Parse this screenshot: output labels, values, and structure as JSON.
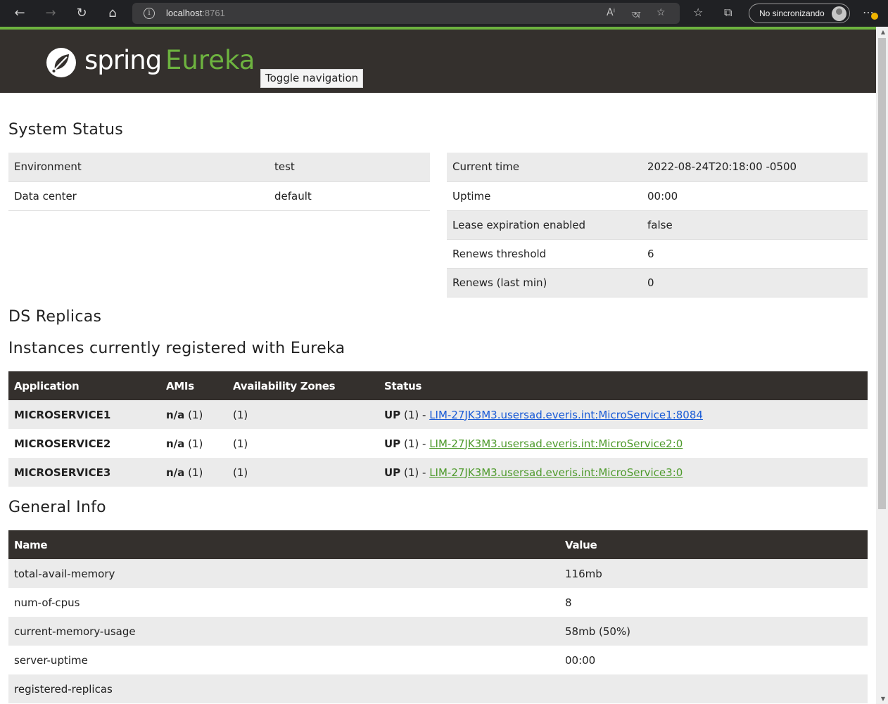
{
  "browser": {
    "url_host": "localhost",
    "url_port": ":8761",
    "profile_label": "No sincronizando"
  },
  "header": {
    "brand": "spring",
    "product": "Eureka",
    "toggle_nav": "Toggle navigation",
    "colors": {
      "bar": "#34302d",
      "accent": "#6db33f"
    }
  },
  "system_status": {
    "title": "System Status",
    "left": [
      {
        "name": "Environment",
        "value": "test"
      },
      {
        "name": "Data center",
        "value": "default"
      }
    ],
    "right": [
      {
        "name": "Current time",
        "value": "2022-08-24T20:18:00 -0500"
      },
      {
        "name": "Uptime",
        "value": "00:00"
      },
      {
        "name": "Lease expiration enabled",
        "value": "false"
      },
      {
        "name": "Renews threshold",
        "value": "6"
      },
      {
        "name": "Renews (last min)",
        "value": "0"
      }
    ]
  },
  "ds_replicas": {
    "title": "DS Replicas"
  },
  "instances": {
    "title": "Instances currently registered with Eureka",
    "headers": [
      "Application",
      "AMIs",
      "Availability Zones",
      "Status"
    ],
    "rows": [
      {
        "app": "MICROSERVICE1",
        "ami": "n/a",
        "ami_count": "(1)",
        "zones": "(1)",
        "status": "UP",
        "status_count": "(1) -",
        "link": "LIM-27JK3M3.usersad.everis.int:MicroService1:8084"
      },
      {
        "app": "MICROSERVICE2",
        "ami": "n/a",
        "ami_count": "(1)",
        "zones": "(1)",
        "status": "UP",
        "status_count": "(1) -",
        "link": "LIM-27JK3M3.usersad.everis.int:MicroService2:0"
      },
      {
        "app": "MICROSERVICE3",
        "ami": "n/a",
        "ami_count": "(1)",
        "zones": "(1)",
        "status": "UP",
        "status_count": "(1) -",
        "link": "LIM-27JK3M3.usersad.everis.int:MicroService3:0"
      }
    ]
  },
  "general_info": {
    "title": "General Info",
    "headers": [
      "Name",
      "Value"
    ],
    "rows": [
      {
        "name": "total-avail-memory",
        "value": "116mb"
      },
      {
        "name": "num-of-cpus",
        "value": "8"
      },
      {
        "name": "current-memory-usage",
        "value": "58mb (50%)"
      },
      {
        "name": "server-uptime",
        "value": "00:00"
      },
      {
        "name": "registered-replicas",
        "value": ""
      }
    ]
  }
}
